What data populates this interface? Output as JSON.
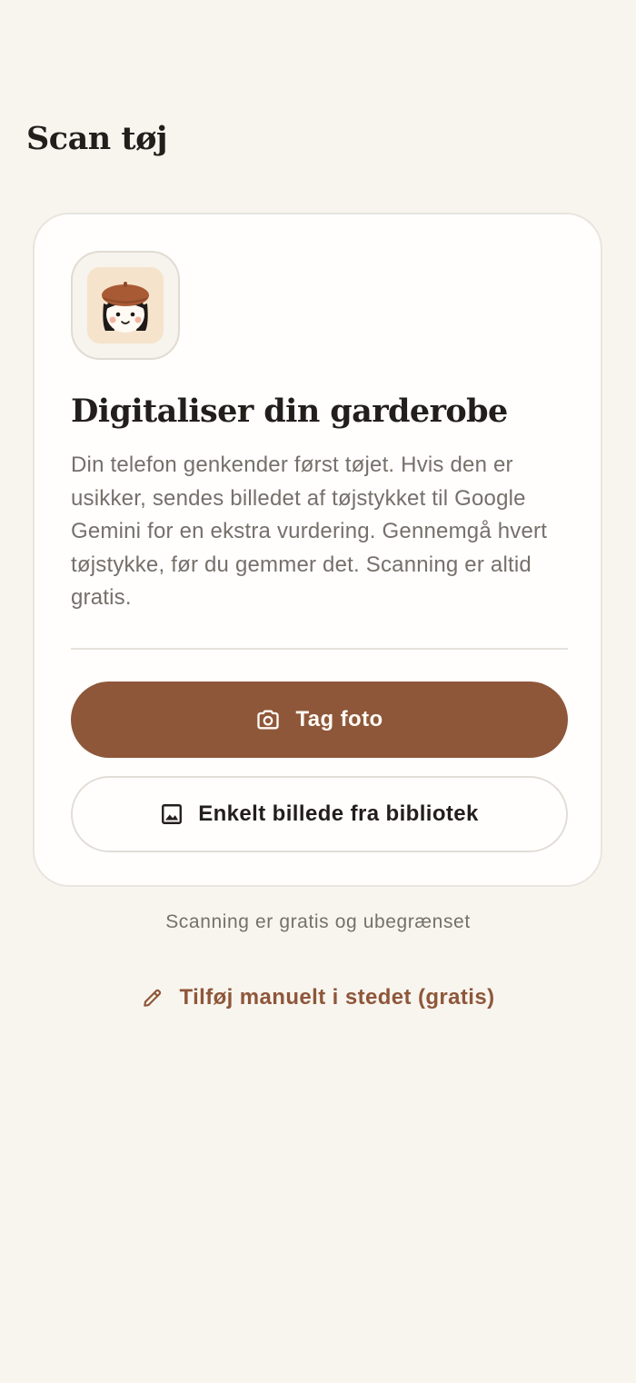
{
  "header": {
    "title": "Scan tøj"
  },
  "card": {
    "avatar_icon": "girl-with-beret-avatar",
    "title": "Digitaliser din garderobe",
    "description": "Din telefon genkender først tøjet. Hvis den er usikker, sendes billedet af tøjstykket til Google Gemini for en ekstra vurdering. Gennemgå hvert tøjstykke, før du gemmer det. Scanning er altid gratis.",
    "primary_button": {
      "label": "Tag foto",
      "icon": "camera-icon"
    },
    "secondary_button": {
      "label": "Enkelt billede fra bibliotek",
      "icon": "image-icon"
    }
  },
  "footnote": "Scanning er gratis og ubegrænset",
  "manual_link": {
    "label": "Tilføj manuelt i stedet (gratis)",
    "icon": "pencil-icon"
  },
  "colors": {
    "background": "#f8f5ef",
    "accent": "#8e573a",
    "card": "#fffefd",
    "text_primary": "#221e1b",
    "text_secondary": "#75706a"
  }
}
